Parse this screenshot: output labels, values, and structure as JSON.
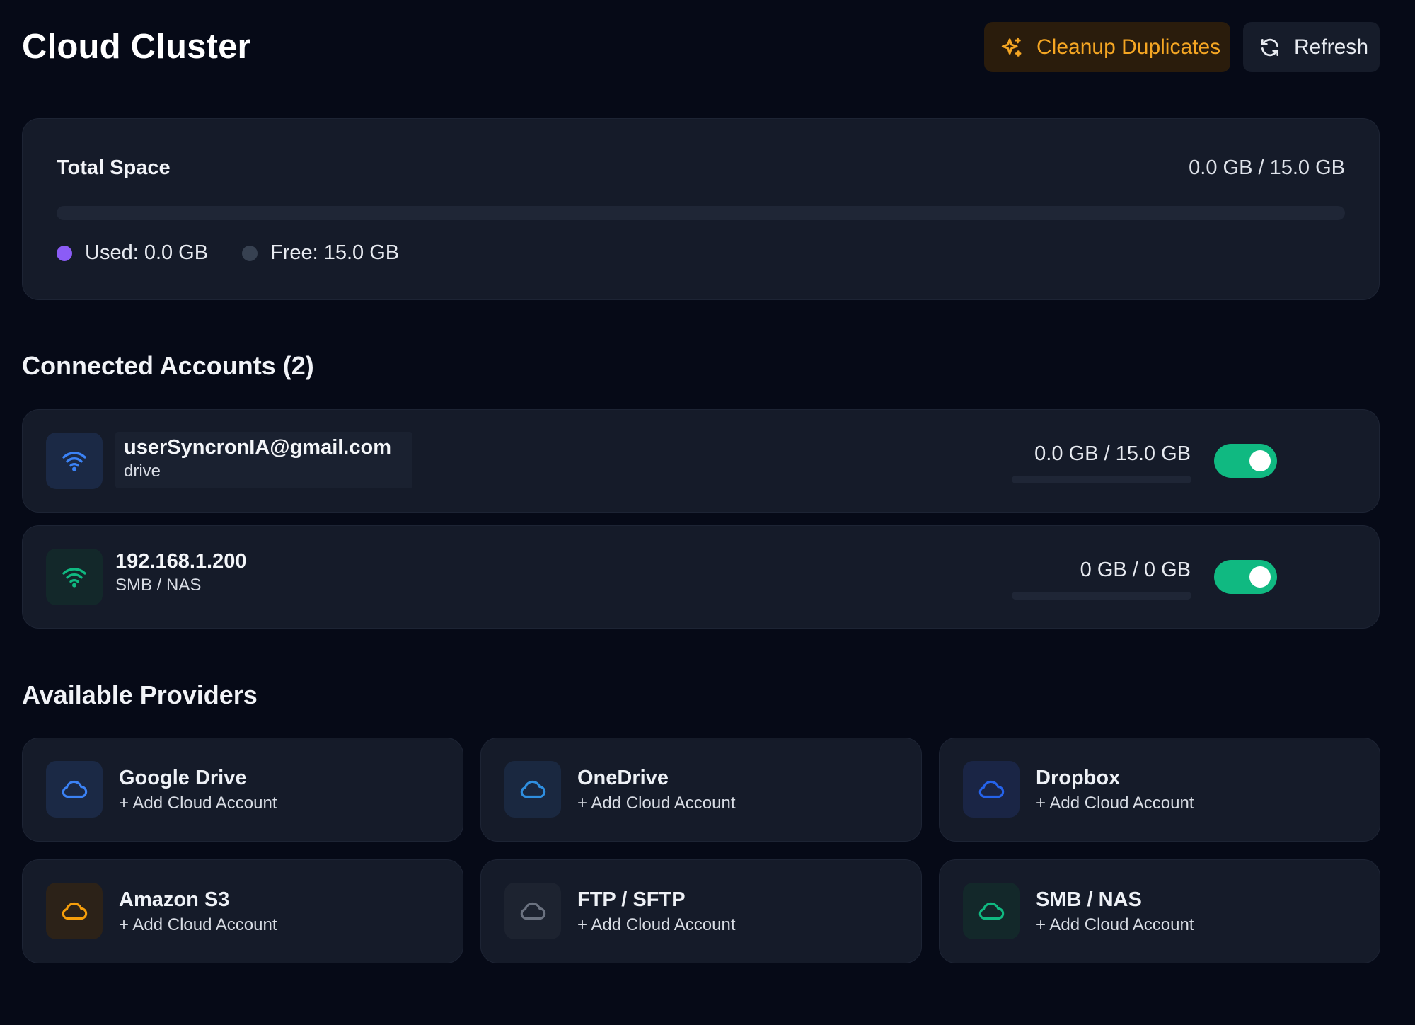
{
  "header": {
    "title": "Cloud Cluster",
    "cleanup_label": "Cleanup Duplicates",
    "refresh_label": "Refresh"
  },
  "total": {
    "label": "Total Space",
    "value": "0.0 GB / 15.0 GB",
    "used_fraction": 0,
    "used_label": "Used: 0.0 GB",
    "free_label": "Free: 15.0 GB"
  },
  "accounts": {
    "heading": "Connected Accounts (2)",
    "items": [
      {
        "name": "userSyncronIA@gmail.com",
        "type": "drive",
        "usage": "0.0 GB / 15.0 GB",
        "used_fraction": 0,
        "enabled": true,
        "icon": "wifi-icon"
      },
      {
        "name": "192.168.1.200",
        "type": "SMB / NAS",
        "usage": "0 GB / 0 GB",
        "used_fraction": 0,
        "enabled": true,
        "icon": "wifi-icon"
      }
    ]
  },
  "providers": {
    "heading": "Available Providers",
    "add_label": "+ Add Cloud Account",
    "items": [
      {
        "name": "Google Drive",
        "icon": "cloud-icon"
      },
      {
        "name": "OneDrive",
        "icon": "cloud-icon"
      },
      {
        "name": "Dropbox",
        "icon": "cloud-icon"
      },
      {
        "name": "Amazon S3",
        "icon": "cloud-icon"
      },
      {
        "name": "FTP / SFTP",
        "icon": "cloud-icon"
      },
      {
        "name": "SMB / NAS",
        "icon": "cloud-icon"
      }
    ]
  },
  "colors": {
    "background": "#060a17",
    "card": "#151b29",
    "accent_orange": "#f5a623",
    "used": "#8b5cf6",
    "free": "#374151",
    "toggle_on": "#10b981",
    "drive_blue": "#3b82f6",
    "smb_green": "#10b981",
    "s3_orange": "#f59e0b",
    "ftp_gray": "#6b7280"
  }
}
